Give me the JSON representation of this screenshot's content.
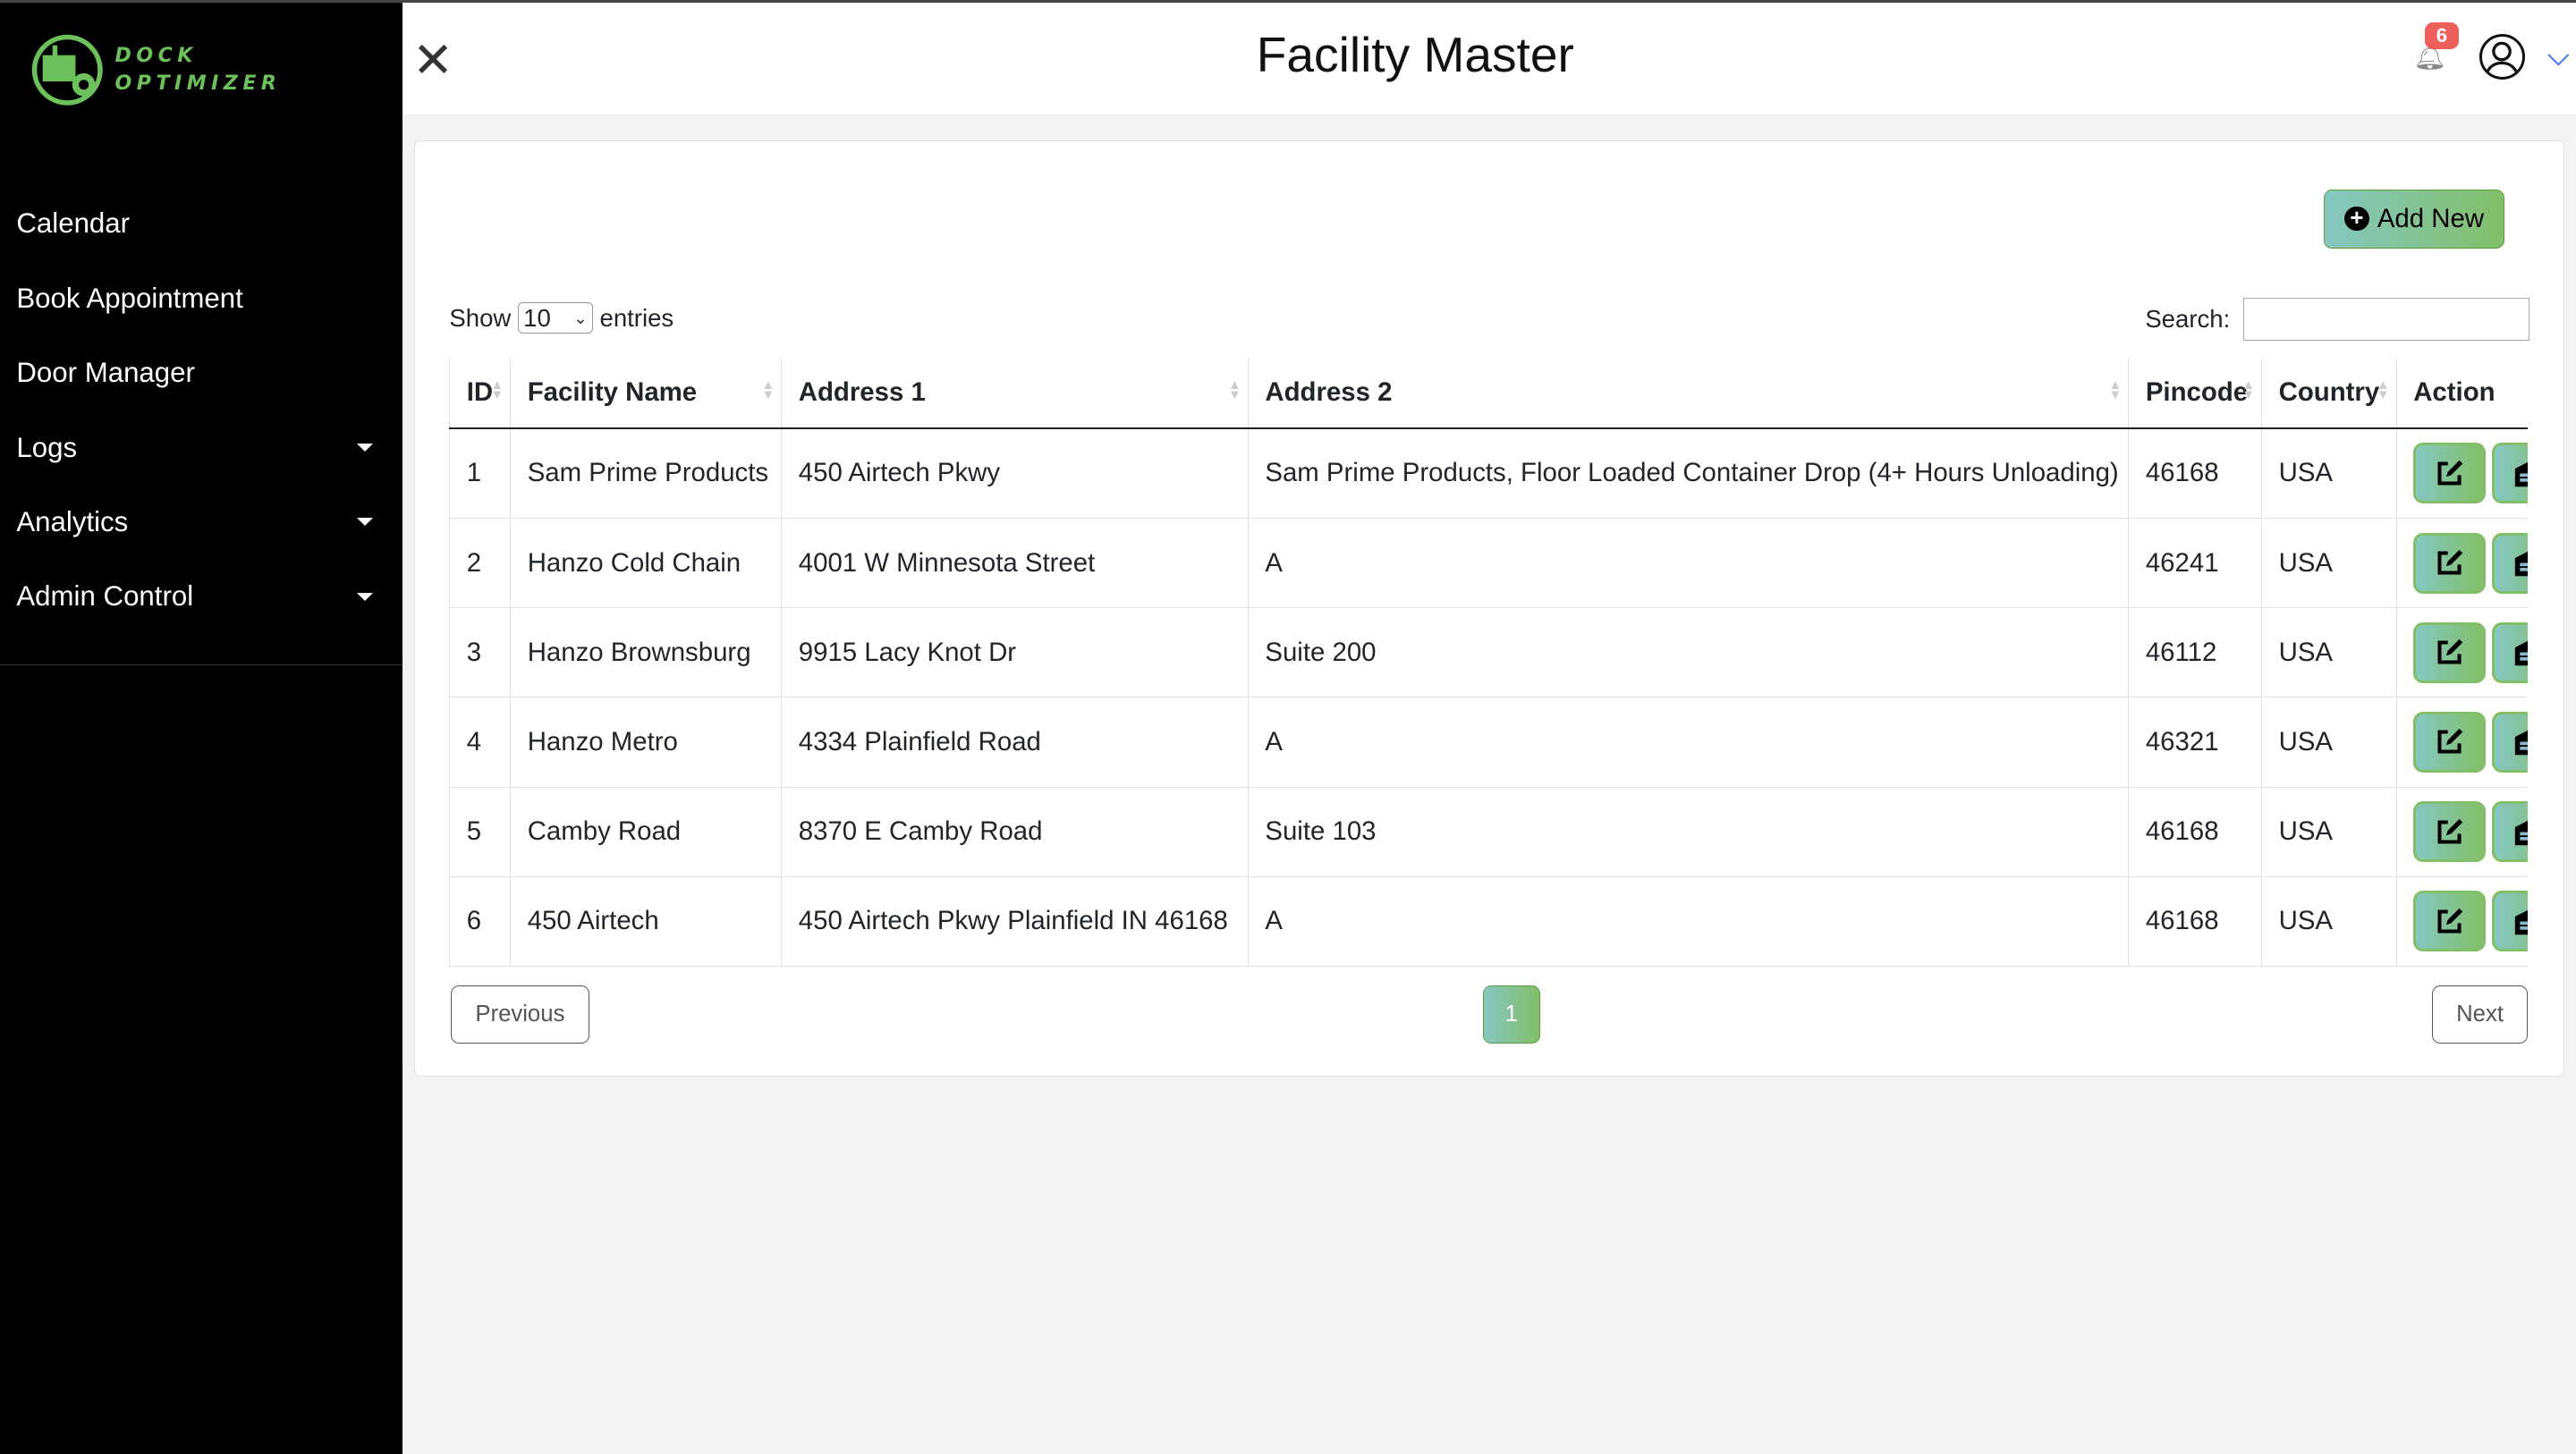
{
  "logo": {
    "line1": "DOCK",
    "line2": "OPTIMIZER"
  },
  "sidebar": {
    "items": [
      {
        "label": "Calendar"
      },
      {
        "label": "Book Appointment"
      },
      {
        "label": "Door Manager"
      },
      {
        "label": "Logs"
      },
      {
        "label": "Analytics"
      },
      {
        "label": "Admin Control"
      }
    ]
  },
  "header": {
    "title": "Facility Master",
    "notification_count": "6"
  },
  "toolbar": {
    "add_new": "Add New",
    "show": "Show",
    "entries_value": "10",
    "entries": "entries",
    "search_label": "Search:",
    "search_value": ""
  },
  "table": {
    "columns": [
      "ID",
      "Facility Name",
      "Address 1",
      "Address 2",
      "Pincode",
      "Country",
      "Action"
    ],
    "rows": [
      [
        "1",
        "Sam Prime Products",
        "450 Airtech Pkwy",
        "Sam Prime Products, Floor Loaded Container Drop (4+ Hours Unloading)",
        "46168",
        "USA"
      ],
      [
        "2",
        "Hanzo Cold Chain",
        "4001 W Minnesota Street",
        "A",
        "46241",
        "USA"
      ],
      [
        "3",
        "Hanzo Brownsburg",
        "9915 Lacy Knot Dr",
        "Suite 200",
        "46112",
        "USA"
      ],
      [
        "4",
        "Hanzo Metro",
        "4334 Plainfield Road",
        "A",
        "46321",
        "USA"
      ],
      [
        "5",
        "Camby Road",
        "8370 E Camby Road",
        "Suite 103",
        "46168",
        "USA"
      ],
      [
        "6",
        "450 Airtech",
        "450 Airtech Pkwy Plainfield IN 46168",
        "A",
        "46168",
        "USA"
      ]
    ]
  },
  "pagination": {
    "previous": "Previous",
    "current": "1",
    "next": "Next"
  }
}
